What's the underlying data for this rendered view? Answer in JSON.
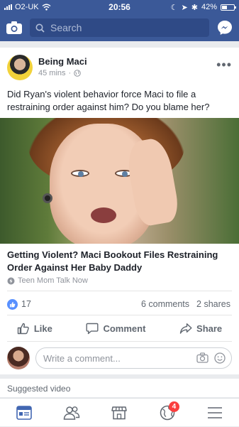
{
  "status_bar": {
    "carrier": "O2-UK",
    "time": "20:56",
    "battery": "42%"
  },
  "navbar": {
    "search_placeholder": "Search",
    "camera_icon": "camera-icon",
    "messenger_icon": "messenger-icon"
  },
  "post": {
    "author": "Being Maci",
    "time": "45 mins",
    "privacy_icon": "globe-icon",
    "text": "Did Ryan's violent behavior force Maci to file a restraining order against him? Do you blame her?",
    "article_title": "Getting Violent? Maci Bookout Files Restraining Order Against Her Baby Daddy",
    "article_source": "Teen Mom Talk Now",
    "likes": "17",
    "comments": "6 comments",
    "shares": "2 shares"
  },
  "actions": {
    "like": "Like",
    "comment": "Comment",
    "share": "Share"
  },
  "comment_box": {
    "placeholder": "Write a comment..."
  },
  "suggested": {
    "label": "Suggested video"
  },
  "tabbar": {
    "tabs": [
      {
        "name": "news-feed",
        "icon": "feed-icon"
      },
      {
        "name": "friends",
        "icon": "friends-icon"
      },
      {
        "name": "marketplace",
        "icon": "store-icon"
      },
      {
        "name": "notifications",
        "icon": "globe-icon",
        "badge": "4"
      },
      {
        "name": "menu",
        "icon": "menu-icon"
      }
    ]
  },
  "colors": {
    "brand": "#3b5998",
    "like_blue": "#5890ff",
    "badge_red": "#fa3e3e"
  }
}
